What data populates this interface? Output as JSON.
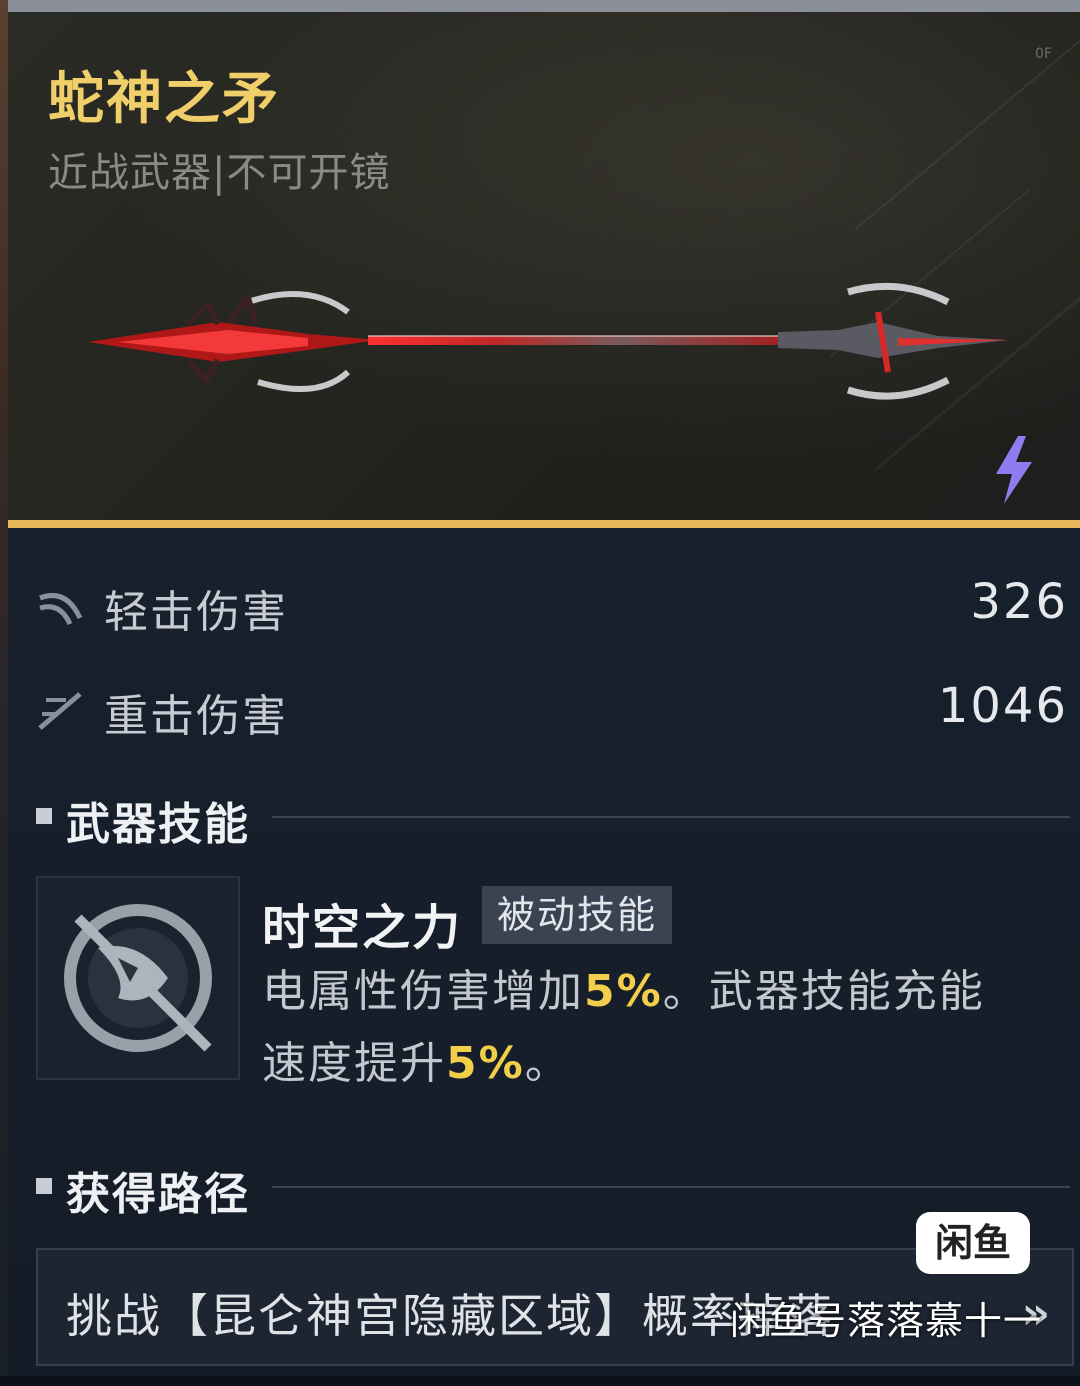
{
  "weapon": {
    "name": "蛇神之矛",
    "type": "近战武器|不可开镜",
    "tag": "0F"
  },
  "stats": [
    {
      "icon": "light-attack-icon",
      "label": "轻击伤害",
      "value": "326"
    },
    {
      "icon": "heavy-attack-icon",
      "label": "重击伤害",
      "value": "1046"
    }
  ],
  "skill_section": {
    "title": "武器技能",
    "skill": {
      "icon": "spacetime-skill-icon",
      "name": "时空之力",
      "badge": "被动技能",
      "desc_part1": "电属性伤害增加",
      "desc_hl1": "5%",
      "desc_part2": "。武器技能充能速度提升",
      "desc_hl2": "5%",
      "desc_part3": "。"
    }
  },
  "source_section": {
    "title": "获得路径",
    "text": "挑战【昆仑神宫隐藏区域】概率掉落",
    "arrow": "»"
  },
  "watermark": {
    "badge": "闲鱼",
    "text": "闲鱼号落落慕十一"
  },
  "colors": {
    "gold": "#f0cf6a",
    "accent_bar": "#e8b85a",
    "highlight": "#f2cf4a",
    "element_bolt": "#8f7cf0"
  }
}
